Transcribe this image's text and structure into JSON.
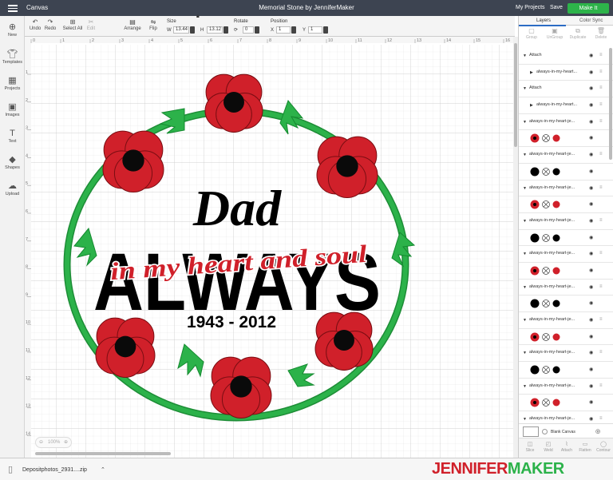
{
  "header": {
    "app": "Canvas",
    "title": "Memorial Stone by JenniferMaker",
    "my_projects": "My Projects",
    "save": "Save",
    "make_it": "Make It"
  },
  "toolbar": {
    "undo": "Undo",
    "redo": "Redo",
    "select_all": "Select All",
    "edit": "Edit",
    "arrange": "Arrange",
    "flip": "Flip",
    "size_label": "Size",
    "w_label": "W",
    "w_value": "13.44",
    "h_label": "H",
    "h_value": "13.12",
    "rotate_label": "Rotate",
    "rotate_value": "0",
    "position_label": "Position",
    "x_label": "X",
    "x_value": "1",
    "y_label": "Y",
    "y_value": "1"
  },
  "sidebar": {
    "items": [
      {
        "label": "New",
        "icon": "plus-icon"
      },
      {
        "label": "Templates",
        "icon": "shirt-icon"
      },
      {
        "label": "Projects",
        "icon": "grid-icon"
      },
      {
        "label": "Images",
        "icon": "image-icon"
      },
      {
        "label": "Text",
        "icon": "text-icon"
      },
      {
        "label": "Shapes",
        "icon": "shapes-icon"
      },
      {
        "label": "Upload",
        "icon": "upload-icon"
      }
    ]
  },
  "ruler": {
    "h": [
      "0",
      "1",
      "2",
      "3",
      "4",
      "5",
      "6",
      "7",
      "8",
      "9",
      "10",
      "11",
      "12",
      "13",
      "14",
      "15",
      "16",
      "17"
    ],
    "v": [
      "1",
      "2",
      "3",
      "4",
      "5",
      "6",
      "7",
      "8",
      "9",
      "10",
      "11",
      "12",
      "13",
      "14",
      "15"
    ]
  },
  "design": {
    "line1": "Dad",
    "line2": "ALWAYS",
    "line3": "in my heart and soul",
    "line4": "1943 - 2012"
  },
  "zoom": {
    "value": "100%"
  },
  "panel": {
    "tab_layers": "Layers",
    "tab_color_sync": "Color Sync",
    "top_tools": [
      "Group",
      "UnGroup",
      "Duplicate",
      "Delete"
    ],
    "rows": [
      {
        "text": "Attach",
        "type": "group"
      },
      {
        "text": "always-in-my-heart...",
        "type": "child"
      },
      {
        "text": "Attach",
        "type": "group"
      },
      {
        "text": "always-in-my-heart...",
        "type": "child"
      },
      {
        "text": "always-in-my-heart-je...",
        "type": "group"
      },
      {
        "text": "",
        "type": "red"
      },
      {
        "text": "always-in-my-heart-je...",
        "type": "group"
      },
      {
        "text": "",
        "type": "black"
      },
      {
        "text": "always-in-my-heart-je...",
        "type": "group"
      },
      {
        "text": "",
        "type": "red"
      },
      {
        "text": "always-in-my-heart-je...",
        "type": "group"
      },
      {
        "text": "",
        "type": "black"
      },
      {
        "text": "always-in-my-heart-je...",
        "type": "group"
      },
      {
        "text": "",
        "type": "red"
      },
      {
        "text": "always-in-my-heart-je...",
        "type": "group"
      },
      {
        "text": "",
        "type": "black"
      },
      {
        "text": "always-in-my-heart-je...",
        "type": "group"
      },
      {
        "text": "",
        "type": "red"
      },
      {
        "text": "always-in-my-heart-je...",
        "type": "group"
      },
      {
        "text": "",
        "type": "black"
      },
      {
        "text": "always-in-my-heart-je...",
        "type": "group"
      },
      {
        "text": "",
        "type": "red"
      },
      {
        "text": "always-in-my-heart-je...",
        "type": "group"
      }
    ],
    "blank_canvas": "Blank Canvas",
    "bottom_tools": [
      "Slice",
      "Weld",
      "Attach",
      "Flatten",
      "Contour"
    ]
  },
  "download": {
    "file": "Depositphotos_2931....zip"
  },
  "brand": {
    "part1": "JENNIFER",
    "part2": "MAKER"
  },
  "colors": {
    "red": "#d0202a",
    "black": "#000000",
    "green": "#22a340",
    "accent": "#2db34a",
    "blue": "#2b6cc4"
  }
}
